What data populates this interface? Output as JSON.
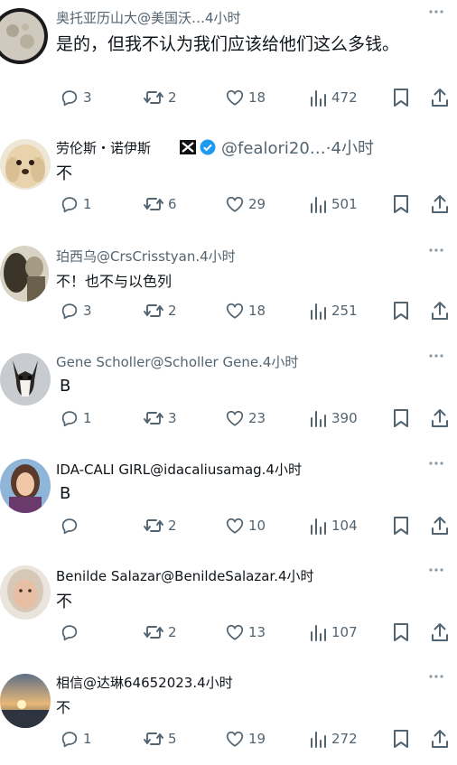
{
  "replies": [
    {
      "author": "奥托亚历山大@美国沃…4小时",
      "text": "是的，但我不认为我们应该给他们这么多钱。",
      "comments": "3",
      "retweets": "2",
      "likes": "18",
      "views": "472"
    },
    {
      "author": "劳伦斯・诺伊斯",
      "handle": "@fealori20…·4小时",
      "text": "不",
      "comments": "1",
      "retweets": "6",
      "likes": "29",
      "views": "501"
    },
    {
      "author": "珀西乌@CrsCrisstyan.4小时",
      "text": "不！也不与以色列",
      "comments": "3",
      "retweets": "2",
      "likes": "18",
      "views": "251"
    },
    {
      "author": "Gene Scholler@Scholler Gene.4小时",
      "text": "B",
      "comments": "1",
      "retweets": "3",
      "likes": "23",
      "views": "390"
    },
    {
      "author": "IDA-CALI GIRL@idacaliusamag.4小时",
      "text": "B",
      "comments": "",
      "retweets": "2",
      "likes": "10",
      "views": "104"
    },
    {
      "author": "Benilde Salazar@BenildeSalazar.4小时",
      "text": "不",
      "comments": "",
      "retweets": "2",
      "likes": "13",
      "views": "107"
    },
    {
      "author": "相信@达琳64652023.4小时",
      "text": "不",
      "comments": "1",
      "retweets": "5",
      "likes": "19",
      "views": "272"
    }
  ],
  "colors": {
    "icon": "#536471",
    "verified": "#1d9bf0",
    "text": "#0f1419"
  }
}
